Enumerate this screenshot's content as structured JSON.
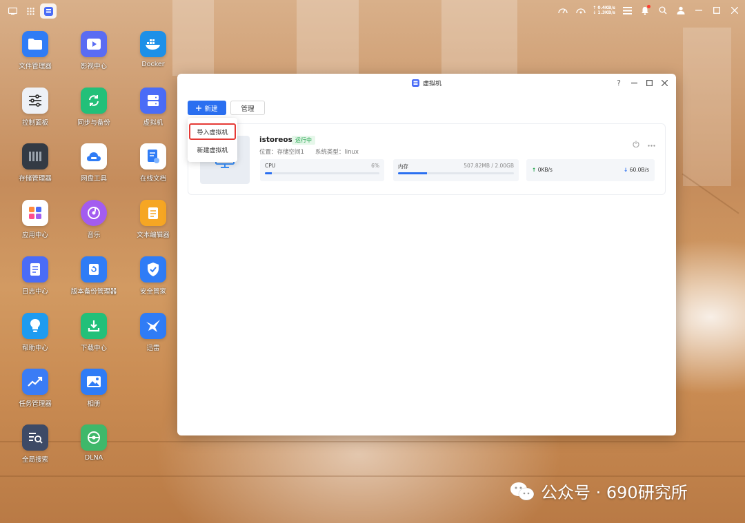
{
  "colors": {
    "accent": "#2a6ff0",
    "running": "#1fa34a",
    "highlight": "#e53935"
  },
  "topbar": {
    "net_up": "↑ 0.4KB/s",
    "net_down": "↓ 1.3KB/s"
  },
  "desktop_icons": [
    {
      "label": "文件管理器",
      "icon": "folder-icon"
    },
    {
      "label": "影视中心",
      "icon": "video-icon"
    },
    {
      "label": "Docker",
      "icon": "docker-icon"
    },
    {
      "label": "控制面板",
      "icon": "sliders-icon"
    },
    {
      "label": "同步与备份",
      "icon": "sync-icon"
    },
    {
      "label": "虚拟机",
      "icon": "vm-icon"
    },
    {
      "label": "存储管理器",
      "icon": "storage-icon"
    },
    {
      "label": "网盘工具",
      "icon": "cloud-drive-icon"
    },
    {
      "label": "在线文档",
      "icon": "doc-cloud-icon"
    },
    {
      "label": "应用中心",
      "icon": "apps-icon"
    },
    {
      "label": "音乐",
      "icon": "music-icon"
    },
    {
      "label": "文本编辑器",
      "icon": "notepad-icon"
    },
    {
      "label": "日志中心",
      "icon": "log-icon"
    },
    {
      "label": "版本备份管理器",
      "icon": "history-icon"
    },
    {
      "label": "安全管家",
      "icon": "shield-icon"
    },
    {
      "label": "帮助中心",
      "icon": "bulb-icon"
    },
    {
      "label": "下载中心",
      "icon": "download-icon"
    },
    {
      "label": "迅雷",
      "icon": "thunder-bird-icon"
    },
    {
      "label": "任务管理器",
      "icon": "chart-icon"
    },
    {
      "label": "相册",
      "icon": "photo-icon"
    },
    {
      "label": "全局搜索",
      "icon": "search-list-icon"
    },
    {
      "label": "DLNA",
      "icon": "dlna-icon"
    }
  ],
  "window": {
    "title": "虚拟机",
    "help": "?",
    "new_button": "新建",
    "manage_button": "管理",
    "dropdown": {
      "import": "导入虚拟机",
      "create": "新建虚拟机"
    },
    "vm": {
      "name": "istoreos",
      "status": "运行中",
      "location": "位置：存储空间1",
      "os": "系统类型：linux",
      "cpu_label": "CPU",
      "cpu_value": "6%",
      "cpu_fraction": 0.06,
      "mem_label": "内存",
      "mem_value": "507.82MB / 2.00GB",
      "mem_fraction": 0.25,
      "net_up": "0KB/s",
      "net_down": "60.0B/s"
    }
  },
  "watermark": "公众号 · 690研究所"
}
